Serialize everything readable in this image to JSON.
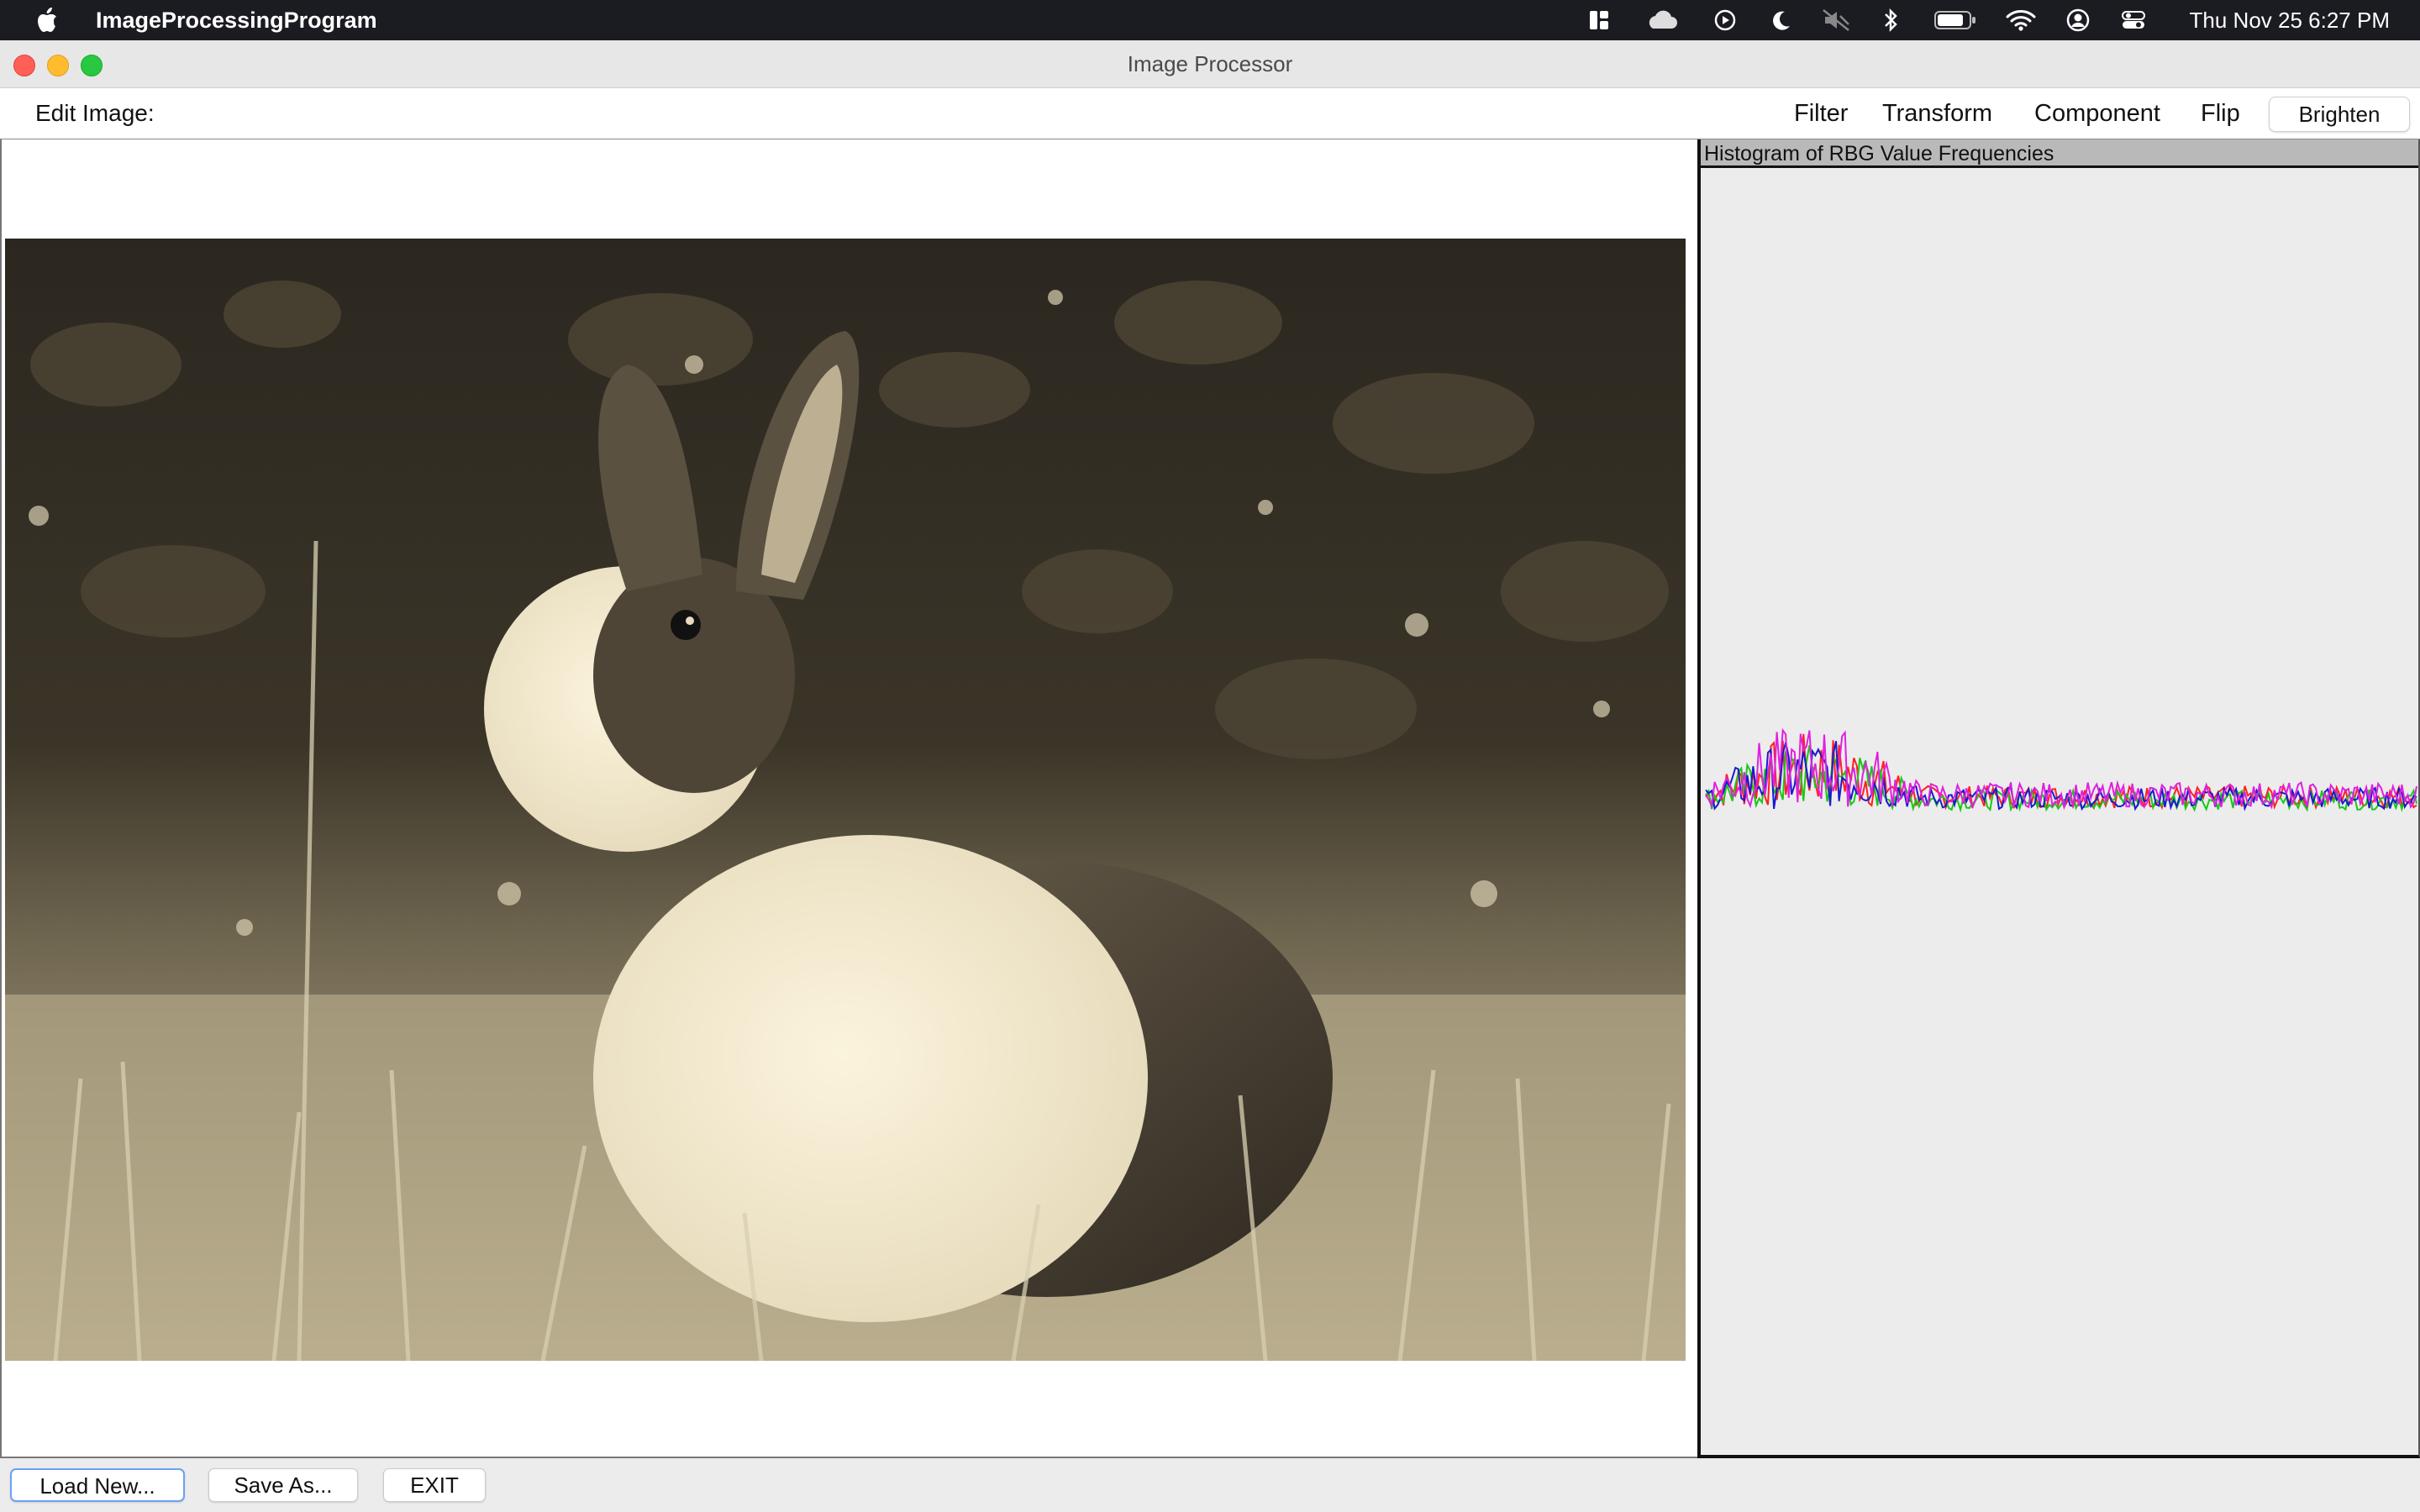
{
  "menubar": {
    "app_name": "ImageProcessingProgram",
    "clock": "Thu Nov 25  6:27 PM",
    "status_icons": [
      "widgets-icon",
      "cloud-icon",
      "play-icon",
      "moon-icon",
      "mute-icon",
      "bluetooth-icon",
      "battery-icon",
      "wifi-icon",
      "user-icon",
      "control-center-icon"
    ]
  },
  "window": {
    "title": "Image Processor"
  },
  "toolbar": {
    "edit_label": "Edit Image:",
    "menus": [
      "Filter",
      "Transform",
      "Component",
      "Flip"
    ],
    "brighten_label": "Brighten"
  },
  "histogram": {
    "title": "Histogram of RBG Value Frequencies",
    "colors": {
      "red": "#ff2020",
      "green": "#18c818",
      "blue": "#1a1ad0",
      "magenta": "#e020e0"
    }
  },
  "buttons": {
    "load": "Load New...",
    "save": "Save As...",
    "exit": "EXIT"
  },
  "photo": {
    "tone": "sepia",
    "colors": {
      "dark": "#2f2a20",
      "mid": "#7a6f58",
      "light": "#efe6cc",
      "grass": "#b8ac8c"
    }
  }
}
